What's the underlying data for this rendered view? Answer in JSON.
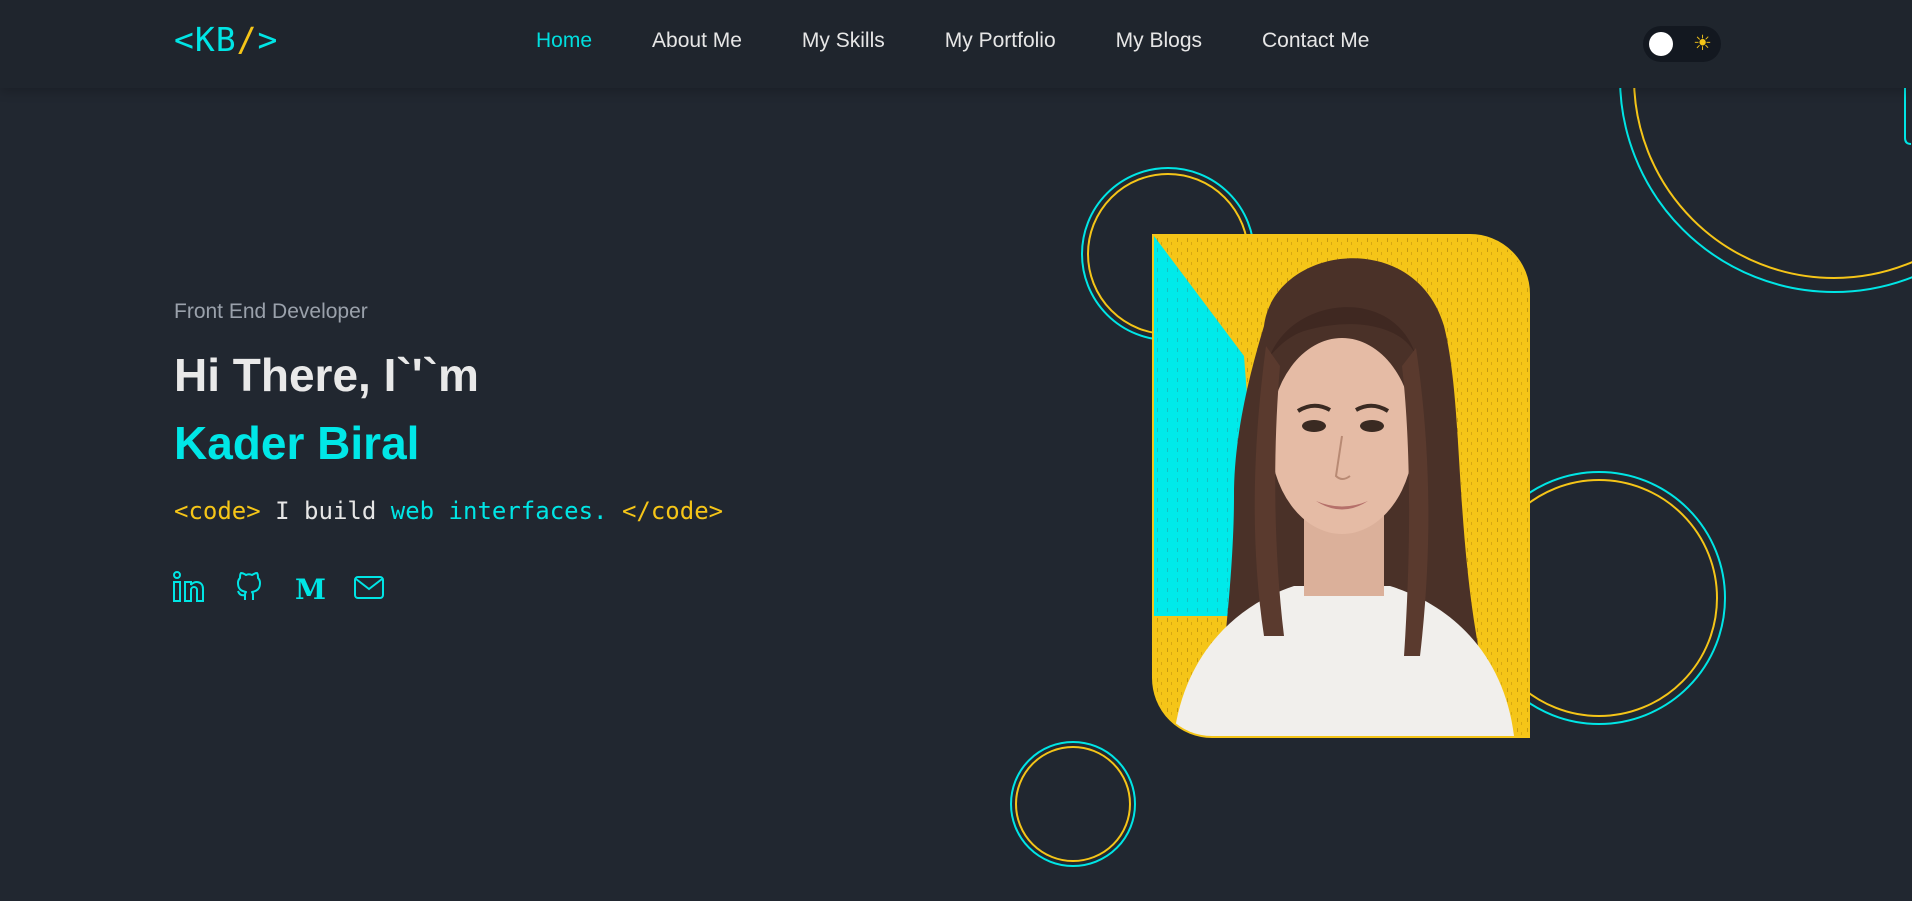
{
  "logo": {
    "text_open": "<KB",
    "text_slash": "/",
    "text_close": ">"
  },
  "nav": {
    "items": [
      "Home",
      "About Me",
      "My Skills",
      "My Portfolio",
      "My Blogs",
      "Contact Me"
    ],
    "active": "Home"
  },
  "theme_toggle": {
    "icon": "sun-icon",
    "state": "dark"
  },
  "hero": {
    "subtitle": "Front End Developer",
    "greeting": "Hi There, I`'`m",
    "name": "Kader Biral",
    "code": {
      "open_tag": "<code>",
      "plain": " I build ",
      "accent": "web interfaces.",
      "close_tag": " </code>"
    },
    "socials": [
      "linkedin-icon",
      "github-icon",
      "medium-icon",
      "mail-icon"
    ]
  },
  "colors": {
    "background": "#212730",
    "accent_cyan": "#00e5e5",
    "accent_yellow": "#f5c518",
    "text": "#e8e8e8"
  }
}
